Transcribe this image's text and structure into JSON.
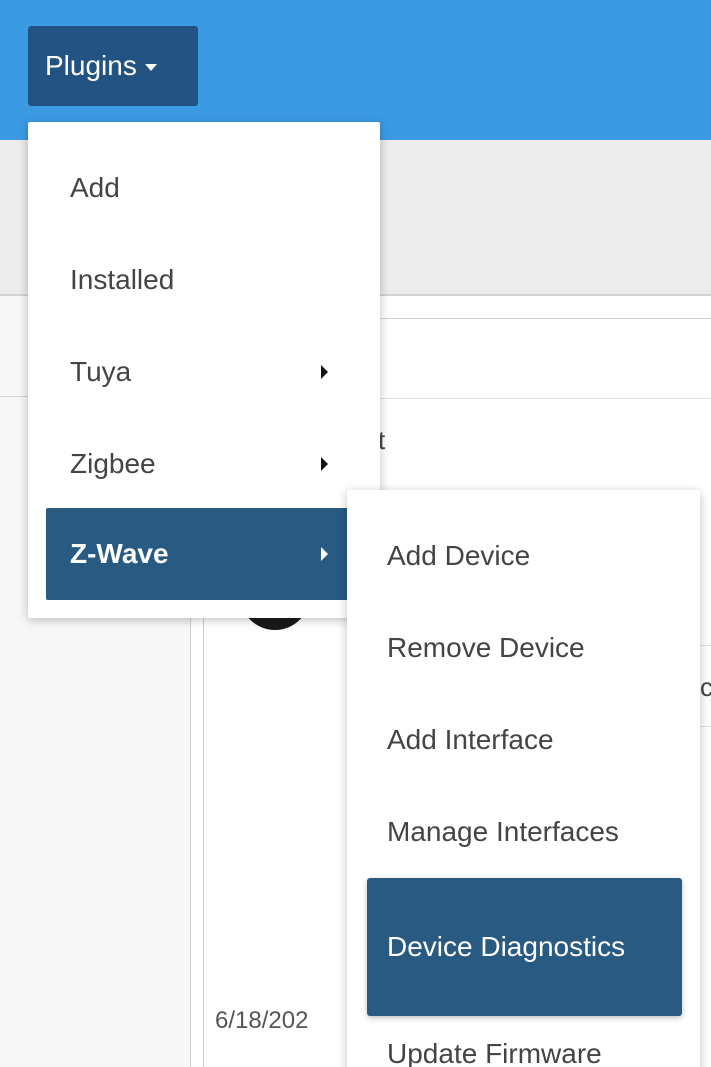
{
  "navbar": {
    "plugins_label": "Plugins"
  },
  "background": {
    "partial_text_1": "t",
    "partial_text_2": "c",
    "partial_date": "6/18/202"
  },
  "plugins_menu": {
    "items": [
      {
        "label": "Add",
        "has_submenu": false
      },
      {
        "label": "Installed",
        "has_submenu": false
      },
      {
        "label": "Tuya",
        "has_submenu": true
      },
      {
        "label": "Zigbee",
        "has_submenu": true
      },
      {
        "label": "Z-Wave",
        "has_submenu": true,
        "active": true
      }
    ]
  },
  "zwave_submenu": {
    "items": [
      {
        "label": "Add Device"
      },
      {
        "label": "Remove Device"
      },
      {
        "label": "Add Interface"
      },
      {
        "label": "Manage Interfaces"
      },
      {
        "label": "Device Diagnostics",
        "active": true
      },
      {
        "label": "Update Firmware"
      }
    ]
  },
  "colors": {
    "navbar_bg": "#3a9be3",
    "active_bg": "#295a82",
    "button_bg": "#235383"
  },
  "icons": {
    "dropdown_caret": "caret-down-icon",
    "submenu_arrow": "caret-right-icon"
  }
}
